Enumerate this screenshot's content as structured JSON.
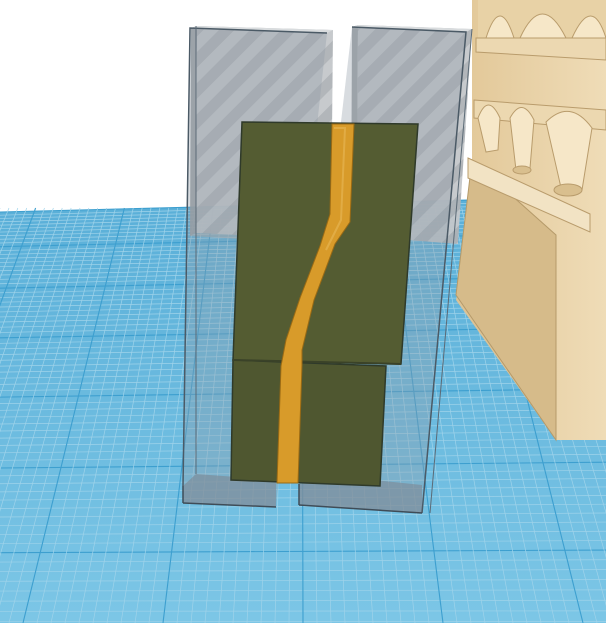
{
  "app": {
    "view": "3D workplane"
  },
  "scene": {
    "background": "#ffffff",
    "workplane": {
      "color": "#6fbcdf",
      "grid_minor_color": "#9fd3ea",
      "grid_major_color": "#3d9fcf"
    },
    "objects": [
      {
        "name": "hole-box-left",
        "type": "hole",
        "color": "#b9bdc0"
      },
      {
        "name": "hole-box-right",
        "type": "hole",
        "color": "#b9bdc0"
      },
      {
        "name": "green-block",
        "type": "solid",
        "color": "#545c32"
      },
      {
        "name": "orange-stripe",
        "type": "solid",
        "color": "#d89b2a"
      },
      {
        "name": "castle-model",
        "type": "solid",
        "color": "#e9d4ac"
      }
    ]
  }
}
